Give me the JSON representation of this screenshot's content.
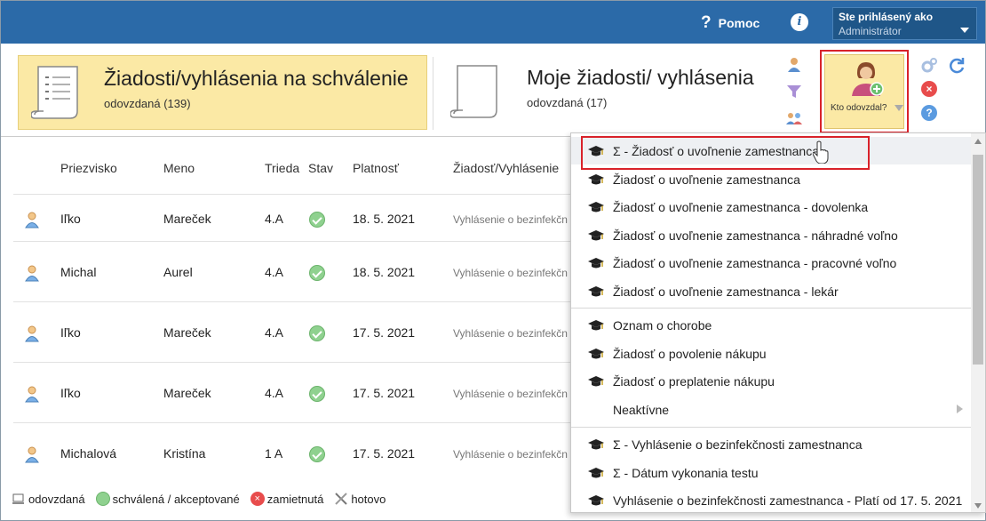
{
  "topbar": {
    "help_label": "Pomoc",
    "help_glyph": "?",
    "info_glyph": "i",
    "user_line1": "Ste prihlásený ako",
    "user_line2": "Administrátor",
    "bg_color": "#2b6aa8"
  },
  "tiles": [
    {
      "title": "Žiadosti/vyhlásenia na schválenie",
      "sub": "odovzdaná (139)",
      "active": true
    },
    {
      "title": "Moje žiadosti/ vyhlásenia",
      "sub": "odovzdaná (17)",
      "active": false
    }
  ],
  "kto_button": {
    "label": "Kto odovzdal?"
  },
  "table": {
    "headers": [
      "Priezvisko",
      "Meno",
      "Trieda",
      "Stav",
      "Platnosť",
      "Žiadosť/Vyhlásenie"
    ],
    "rows": [
      {
        "surname": "Iľko",
        "name": "Mareček",
        "class": "4.A",
        "status": "ok",
        "valid": "18. 5. 2021",
        "type": "Vyhlásenie o bezinfekčn"
      },
      {
        "surname": "Michal",
        "name": "Aurel",
        "class": "4.A",
        "status": "ok",
        "valid": "18. 5. 2021",
        "type": "Vyhlásenie o bezinfekčn"
      },
      {
        "surname": "Iľko",
        "name": "Mareček",
        "class": "4.A",
        "status": "ok",
        "valid": "17. 5. 2021",
        "type": "Vyhlásenie o bezinfekčn"
      },
      {
        "surname": "Iľko",
        "name": "Mareček",
        "class": "4.A",
        "status": "ok",
        "valid": "17. 5. 2021",
        "type": "Vyhlásenie o bezinfekčn"
      },
      {
        "surname": "Michalová",
        "name": "Kristína",
        "class": "1 A",
        "status": "ok",
        "valid": "17. 5. 2021",
        "type": "Vyhlásenie o bezinfekčn"
      }
    ]
  },
  "legend": {
    "submitted": "odovzdaná",
    "approved": "schválená / akceptované",
    "rejected": "zamietnutá",
    "done": "hotovo"
  },
  "dropdown": {
    "items": [
      {
        "label": "Σ - Žiadosť o uvoľnenie zamestnanca",
        "icon": "graduation-cap-icon",
        "highlighted": true
      },
      {
        "label": "Žiadosť o uvoľnenie zamestnanca",
        "icon": "graduation-cap-icon"
      },
      {
        "label": "Žiadosť o uvoľnenie zamestnanca - dovolenka",
        "icon": "graduation-cap-icon"
      },
      {
        "label": "Žiadosť o uvoľnenie zamestnanca - náhradné voľno",
        "icon": "graduation-cap-icon"
      },
      {
        "label": "Žiadosť o uvoľnenie zamestnanca - pracovné voľno",
        "icon": "graduation-cap-icon"
      },
      {
        "label": "Žiadosť o uvoľnenie zamestnanca - lekár",
        "icon": "graduation-cap-icon"
      },
      {
        "label": "Oznam o chorobe",
        "icon": "graduation-cap-icon"
      },
      {
        "label": "Žiadosť o povolenie nákupu",
        "icon": "graduation-cap-icon"
      },
      {
        "label": "Žiadosť o preplatenie nákupu",
        "icon": "graduation-cap-icon"
      },
      {
        "label": "Neaktívne",
        "icon": "",
        "submenu": true
      },
      {
        "label": "Σ - Vyhlásenie o bezinfekčnosti zamestnanca",
        "icon": "graduation-cap-icon"
      },
      {
        "label": "Σ - Dátum vykonania testu",
        "icon": "graduation-cap-icon"
      },
      {
        "label": "Vyhlásenie o bezinfekčnosti zamestnanca - Platí od 17. 5. 2021",
        "icon": "graduation-cap-icon"
      }
    ]
  },
  "colors": {
    "accent_yellow": "#fbe9a5",
    "highlight_red": "#d9222a",
    "ok_green": "#8fd18f",
    "reject_red": "#e84c4c",
    "help_blue": "#5b9be0"
  }
}
